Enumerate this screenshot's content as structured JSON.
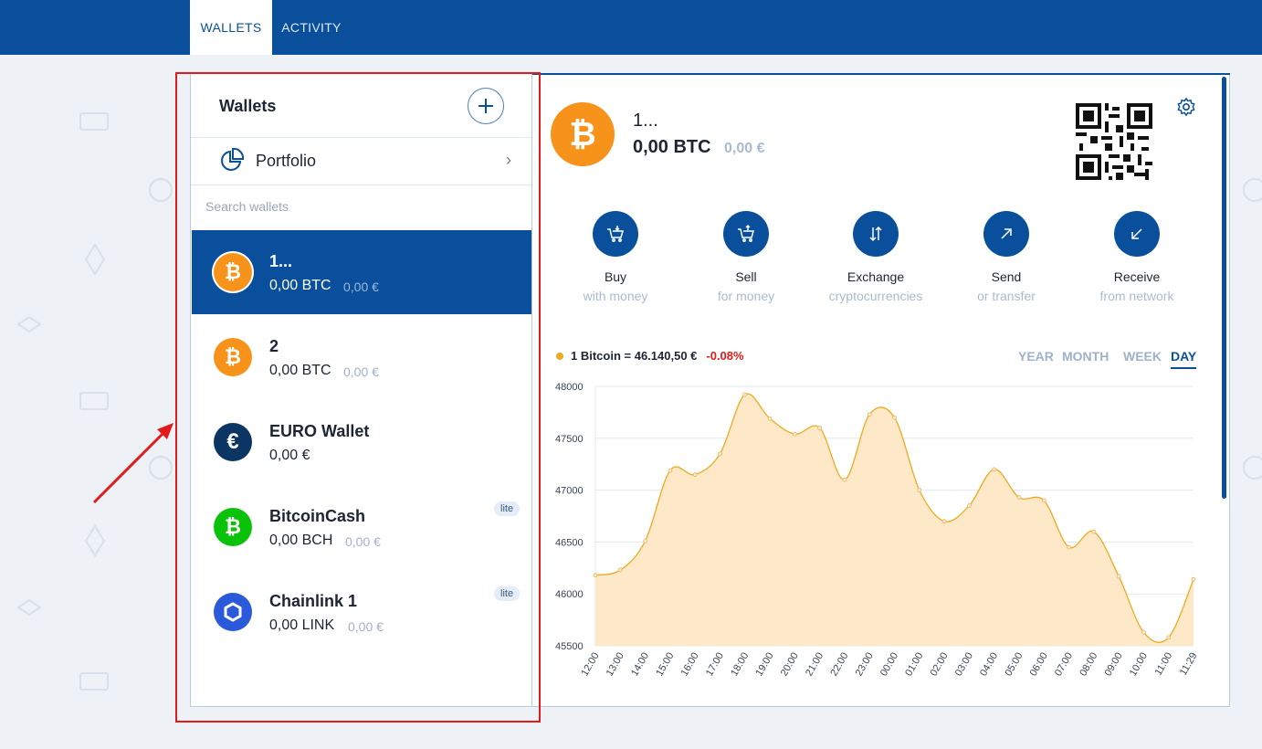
{
  "nav": {
    "tabs": [
      {
        "label": "WALLETS",
        "active": true
      },
      {
        "label": "ACTIVITY",
        "active": false
      }
    ]
  },
  "sidebar": {
    "title": "Wallets",
    "portfolio_label": "Portfolio",
    "search_placeholder": "Search wallets",
    "wallets": [
      {
        "name": "1...",
        "balance": "0,00 BTC",
        "fiat": "0,00 €",
        "icon": "bitcoin-icon",
        "selected": true
      },
      {
        "name": "2",
        "balance": "0,00 BTC",
        "fiat": "0,00 €",
        "icon": "bitcoin-icon",
        "selected": false
      },
      {
        "name": "EURO Wallet",
        "balance": "0,00 €",
        "icon": "euro-icon",
        "selected": false
      },
      {
        "name": "BitcoinCash",
        "balance": "0,00 BCH",
        "fiat": "0,00 €",
        "icon": "bitcoin-cash-icon",
        "badge": "lite",
        "selected": false
      },
      {
        "name": "Chainlink 1",
        "balance": "0,00 LINK",
        "fiat": "0,00 €",
        "icon": "chainlink-icon",
        "badge": "lite",
        "selected": false
      }
    ]
  },
  "detail": {
    "name": "1...",
    "balance": "0,00 BTC",
    "fiat": "0,00 €",
    "actions": [
      {
        "label": "Buy",
        "sub": "with money",
        "icon": "cart-in-icon"
      },
      {
        "label": "Sell",
        "sub": "for money",
        "icon": "cart-out-icon"
      },
      {
        "label": "Exchange",
        "sub": "cryptocurrencies",
        "icon": "exchange-arrows-icon"
      },
      {
        "label": "Send",
        "sub": "or transfer",
        "icon": "arrow-up-right-icon"
      },
      {
        "label": "Receive",
        "sub": "from network",
        "icon": "arrow-down-left-icon"
      }
    ],
    "price_label": "1 Bitcoin = 46.140,50 €",
    "price_change": "-0.08%",
    "periods": [
      {
        "label": "YEAR",
        "active": false
      },
      {
        "label": "MONTH",
        "active": false
      },
      {
        "label": "WEEK",
        "active": false
      },
      {
        "label": "DAY",
        "active": true
      }
    ]
  },
  "colors": {
    "primary": "#0a4f9b",
    "bitcoin": "#f7931a",
    "annotation": "#e21a1a"
  },
  "chart_data": {
    "type": "area",
    "x": [
      "12:00",
      "13:00",
      "14:00",
      "15:00",
      "16:00",
      "17:00",
      "18:00",
      "19:00",
      "20:00",
      "21:00",
      "22:00",
      "23:00",
      "00:00",
      "01:00",
      "02:00",
      "03:00",
      "04:00",
      "05:00",
      "06:00",
      "07:00",
      "08:00",
      "09:00",
      "10:00",
      "11:00",
      "11:29"
    ],
    "series": [
      {
        "values": [
          46180,
          46230,
          46510,
          47190,
          47150,
          47350,
          47920,
          47690,
          47540,
          47600,
          47100,
          47730,
          47700,
          47000,
          46700,
          46850,
          47200,
          46930,
          46900,
          46450,
          46600,
          46170,
          45630,
          45580,
          46140
        ]
      }
    ],
    "ylim": [
      45500,
      48000
    ],
    "yticks": [
      48000,
      47500,
      47000,
      46500,
      46000,
      45500
    ],
    "grid": true
  }
}
